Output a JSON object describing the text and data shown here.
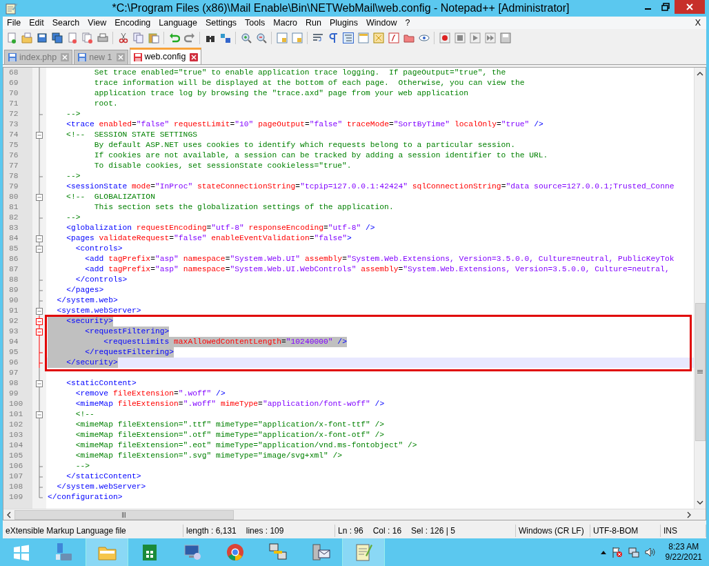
{
  "window": {
    "title": "*C:\\Program Files (x86)\\Mail Enable\\Bin\\NETWebMail\\web.config - Notepad++ [Administrator]"
  },
  "menu": [
    "File",
    "Edit",
    "Search",
    "View",
    "Encoding",
    "Language",
    "Settings",
    "Tools",
    "Macro",
    "Run",
    "Plugins",
    "Window",
    "?"
  ],
  "menu_close": "X",
  "tabs": [
    {
      "label": "index.php",
      "selected": false,
      "modified": false
    },
    {
      "label": "new 1",
      "selected": false,
      "modified": false
    },
    {
      "label": "web.config",
      "selected": true,
      "modified": true
    }
  ],
  "lines": [
    {
      "number": "68",
      "kind": "comment",
      "fold_start": false,
      "fold_end": false,
      "selected": false,
      "current": false,
      "text": "          Set trace enabled=\"true\" to enable application trace logging.  If pageOutput=\"true\", the"
    },
    {
      "number": "69",
      "kind": "comment",
      "fold_start": false,
      "fold_end": false,
      "selected": false,
      "current": false,
      "text": "          trace information will be displayed at the bottom of each page.  Otherwise, you can view the"
    },
    {
      "number": "70",
      "kind": "comment",
      "fold_start": false,
      "fold_end": false,
      "selected": false,
      "current": false,
      "text": "          application trace log by browsing the \"trace.axd\" page from your web application"
    },
    {
      "number": "71",
      "kind": "comment",
      "fold_start": false,
      "fold_end": false,
      "selected": false,
      "current": false,
      "text": "          root."
    },
    {
      "number": "72",
      "kind": "comment",
      "fold_start": false,
      "fold_end": true,
      "selected": false,
      "current": false,
      "text": "    -->"
    },
    {
      "number": "73",
      "kind": "code",
      "fold_start": false,
      "fold_end": false,
      "selected": false,
      "current": false,
      "text": "    <trace enabled=\"false\" requestLimit=\"10\" pageOutput=\"false\" traceMode=\"SortByTime\" localOnly=\"true\" />"
    },
    {
      "number": "74",
      "kind": "comment",
      "fold_start": true,
      "fold_end": false,
      "selected": false,
      "current": false,
      "text": "    <!--  SESSION STATE SETTINGS"
    },
    {
      "number": "75",
      "kind": "comment",
      "fold_start": false,
      "fold_end": false,
      "selected": false,
      "current": false,
      "text": "          By default ASP.NET uses cookies to identify which requests belong to a particular session."
    },
    {
      "number": "76",
      "kind": "comment",
      "fold_start": false,
      "fold_end": false,
      "selected": false,
      "current": false,
      "text": "          If cookies are not available, a session can be tracked by adding a session identifier to the URL."
    },
    {
      "number": "77",
      "kind": "comment",
      "fold_start": false,
      "fold_end": false,
      "selected": false,
      "current": false,
      "text": "          To disable cookies, set sessionState cookieless=\"true\"."
    },
    {
      "number": "78",
      "kind": "comment",
      "fold_start": false,
      "fold_end": true,
      "selected": false,
      "current": false,
      "text": "    -->"
    },
    {
      "number": "79",
      "kind": "code",
      "fold_start": false,
      "fold_end": false,
      "selected": false,
      "current": false,
      "text": "    <sessionState mode=\"InProc\" stateConnectionString=\"tcpip=127.0.0.1:42424\" sqlConnectionString=\"data source=127.0.0.1;Trusted_Conne"
    },
    {
      "number": "80",
      "kind": "comment",
      "fold_start": true,
      "fold_end": false,
      "selected": false,
      "current": false,
      "text": "    <!--  GLOBALIZATION"
    },
    {
      "number": "81",
      "kind": "comment",
      "fold_start": false,
      "fold_end": false,
      "selected": false,
      "current": false,
      "text": "          This section sets the globalization settings of the application."
    },
    {
      "number": "82",
      "kind": "comment",
      "fold_start": false,
      "fold_end": true,
      "selected": false,
      "current": false,
      "text": "    -->"
    },
    {
      "number": "83",
      "kind": "code",
      "fold_start": false,
      "fold_end": false,
      "selected": false,
      "current": false,
      "text": "    <globalization requestEncoding=\"utf-8\" responseEncoding=\"utf-8\" />"
    },
    {
      "number": "84",
      "kind": "code",
      "fold_start": true,
      "fold_end": false,
      "selected": false,
      "current": false,
      "text": "    <pages validateRequest=\"false\" enableEventValidation=\"false\">"
    },
    {
      "number": "85",
      "kind": "code",
      "fold_start": true,
      "fold_end": false,
      "selected": false,
      "current": false,
      "text": "      <controls>"
    },
    {
      "number": "86",
      "kind": "code",
      "fold_start": false,
      "fold_end": false,
      "selected": false,
      "current": false,
      "text": "        <add tagPrefix=\"asp\" namespace=\"System.Web.UI\" assembly=\"System.Web.Extensions, Version=3.5.0.0, Culture=neutral, PublicKeyTok"
    },
    {
      "number": "87",
      "kind": "code",
      "fold_start": false,
      "fold_end": false,
      "selected": false,
      "current": false,
      "text": "        <add tagPrefix=\"asp\" namespace=\"System.Web.UI.WebControls\" assembly=\"System.Web.Extensions, Version=3.5.0.0, Culture=neutral,"
    },
    {
      "number": "88",
      "kind": "code",
      "fold_start": false,
      "fold_end": true,
      "selected": false,
      "current": false,
      "text": "      </controls>"
    },
    {
      "number": "89",
      "kind": "code",
      "fold_start": false,
      "fold_end": true,
      "selected": false,
      "current": false,
      "text": "    </pages>"
    },
    {
      "number": "90",
      "kind": "code",
      "fold_start": false,
      "fold_end": true,
      "selected": false,
      "current": false,
      "text": "  </system.web>"
    },
    {
      "number": "91",
      "kind": "code",
      "fold_start": true,
      "fold_end": false,
      "selected": false,
      "current": false,
      "text": "  <system.webServer>"
    },
    {
      "number": "92",
      "kind": "code",
      "fold_start": true,
      "fold_end": false,
      "selected": true,
      "current": false,
      "text": "    <security>"
    },
    {
      "number": "93",
      "kind": "code",
      "fold_start": true,
      "fold_end": false,
      "selected": true,
      "current": false,
      "text": "        <requestFiltering>"
    },
    {
      "number": "94",
      "kind": "code",
      "fold_start": false,
      "fold_end": false,
      "selected": true,
      "current": false,
      "text": "            <requestLimits maxAllowedContentLength=\"10240000\" />"
    },
    {
      "number": "95",
      "kind": "code",
      "fold_start": false,
      "fold_end": true,
      "selected": true,
      "current": false,
      "text": "        </requestFiltering>"
    },
    {
      "number": "96",
      "kind": "code",
      "fold_start": false,
      "fold_end": true,
      "selected": true,
      "current": true,
      "text": "    </security>"
    },
    {
      "number": "97",
      "fold_start": false,
      "fold_end": false,
      "selected": false,
      "current": false
    },
    {
      "number": "98",
      "kind": "code",
      "fold_start": true,
      "fold_end": false,
      "selected": false,
      "current": false,
      "text": "    <staticContent>"
    },
    {
      "number": "99",
      "kind": "code",
      "fold_start": false,
      "fold_end": false,
      "selected": false,
      "current": false,
      "text": "      <remove fileExtension=\".woff\" />"
    },
    {
      "number": "100",
      "kind": "code",
      "fold_start": false,
      "fold_end": false,
      "selected": false,
      "current": false,
      "text": "      <mimeMap fileExtension=\".woff\" mimeType=\"application/font-woff\" />"
    },
    {
      "number": "101",
      "kind": "comment",
      "fold_start": true,
      "fold_end": false,
      "selected": false,
      "current": false,
      "text": "      <!--"
    },
    {
      "number": "102",
      "kind": "comment",
      "fold_start": false,
      "fold_end": false,
      "selected": false,
      "current": false,
      "text": "      <mimeMap fileExtension=\".ttf\" mimeType=\"application/x-font-ttf\" />"
    },
    {
      "number": "103",
      "kind": "comment",
      "fold_start": false,
      "fold_end": false,
      "selected": false,
      "current": false,
      "text": "      <mimeMap fileExtension=\".otf\" mimeType=\"application/x-font-otf\" />"
    },
    {
      "number": "104",
      "kind": "comment",
      "fold_start": false,
      "fold_end": false,
      "selected": false,
      "current": false,
      "text": "      <mimeMap fileExtension=\".eot\" mimeType=\"application/vnd.ms-fontobject\" />"
    },
    {
      "number": "105",
      "kind": "comment",
      "fold_start": false,
      "fold_end": false,
      "selected": false,
      "current": false,
      "text": "      <mimeMap fileExtension=\".svg\" mimeType=\"image/svg+xml\" />"
    },
    {
      "number": "106",
      "kind": "comment",
      "fold_start": false,
      "fold_end": true,
      "selected": false,
      "current": false,
      "text": "      -->"
    },
    {
      "number": "107",
      "kind": "code",
      "fold_start": false,
      "fold_end": true,
      "selected": false,
      "current": false,
      "text": "    </staticContent>"
    },
    {
      "number": "108",
      "kind": "code",
      "fold_start": false,
      "fold_end": true,
      "selected": false,
      "current": false,
      "text": "  </system.webServer>"
    },
    {
      "number": "109",
      "kind": "code",
      "fold_start": false,
      "fold_end": true,
      "selected": false,
      "current": false,
      "text": "</configuration>"
    }
  ],
  "highlight_box": {
    "shown": true
  },
  "status_bar": [
    [
      "eXtensible Markup Language file"
    ],
    [
      "length : 6,131",
      "lines : 109"
    ],
    [
      "Ln : 96",
      "Col : 16",
      "Sel : 126 | 5"
    ],
    [
      "Windows (CR LF)"
    ],
    [
      "UTF-8-BOM"
    ],
    [
      "INS"
    ]
  ],
  "taskbar": {
    "apps": [
      {
        "selected": false
      },
      {
        "selected": false
      },
      {
        "selected": true
      },
      {
        "selected": false
      },
      {
        "selected": false
      },
      {
        "selected": false
      },
      {
        "selected": false
      },
      {
        "selected": false
      },
      {
        "selected": true
      }
    ],
    "time": "8:23 AM",
    "date": "9/22/2021"
  }
}
